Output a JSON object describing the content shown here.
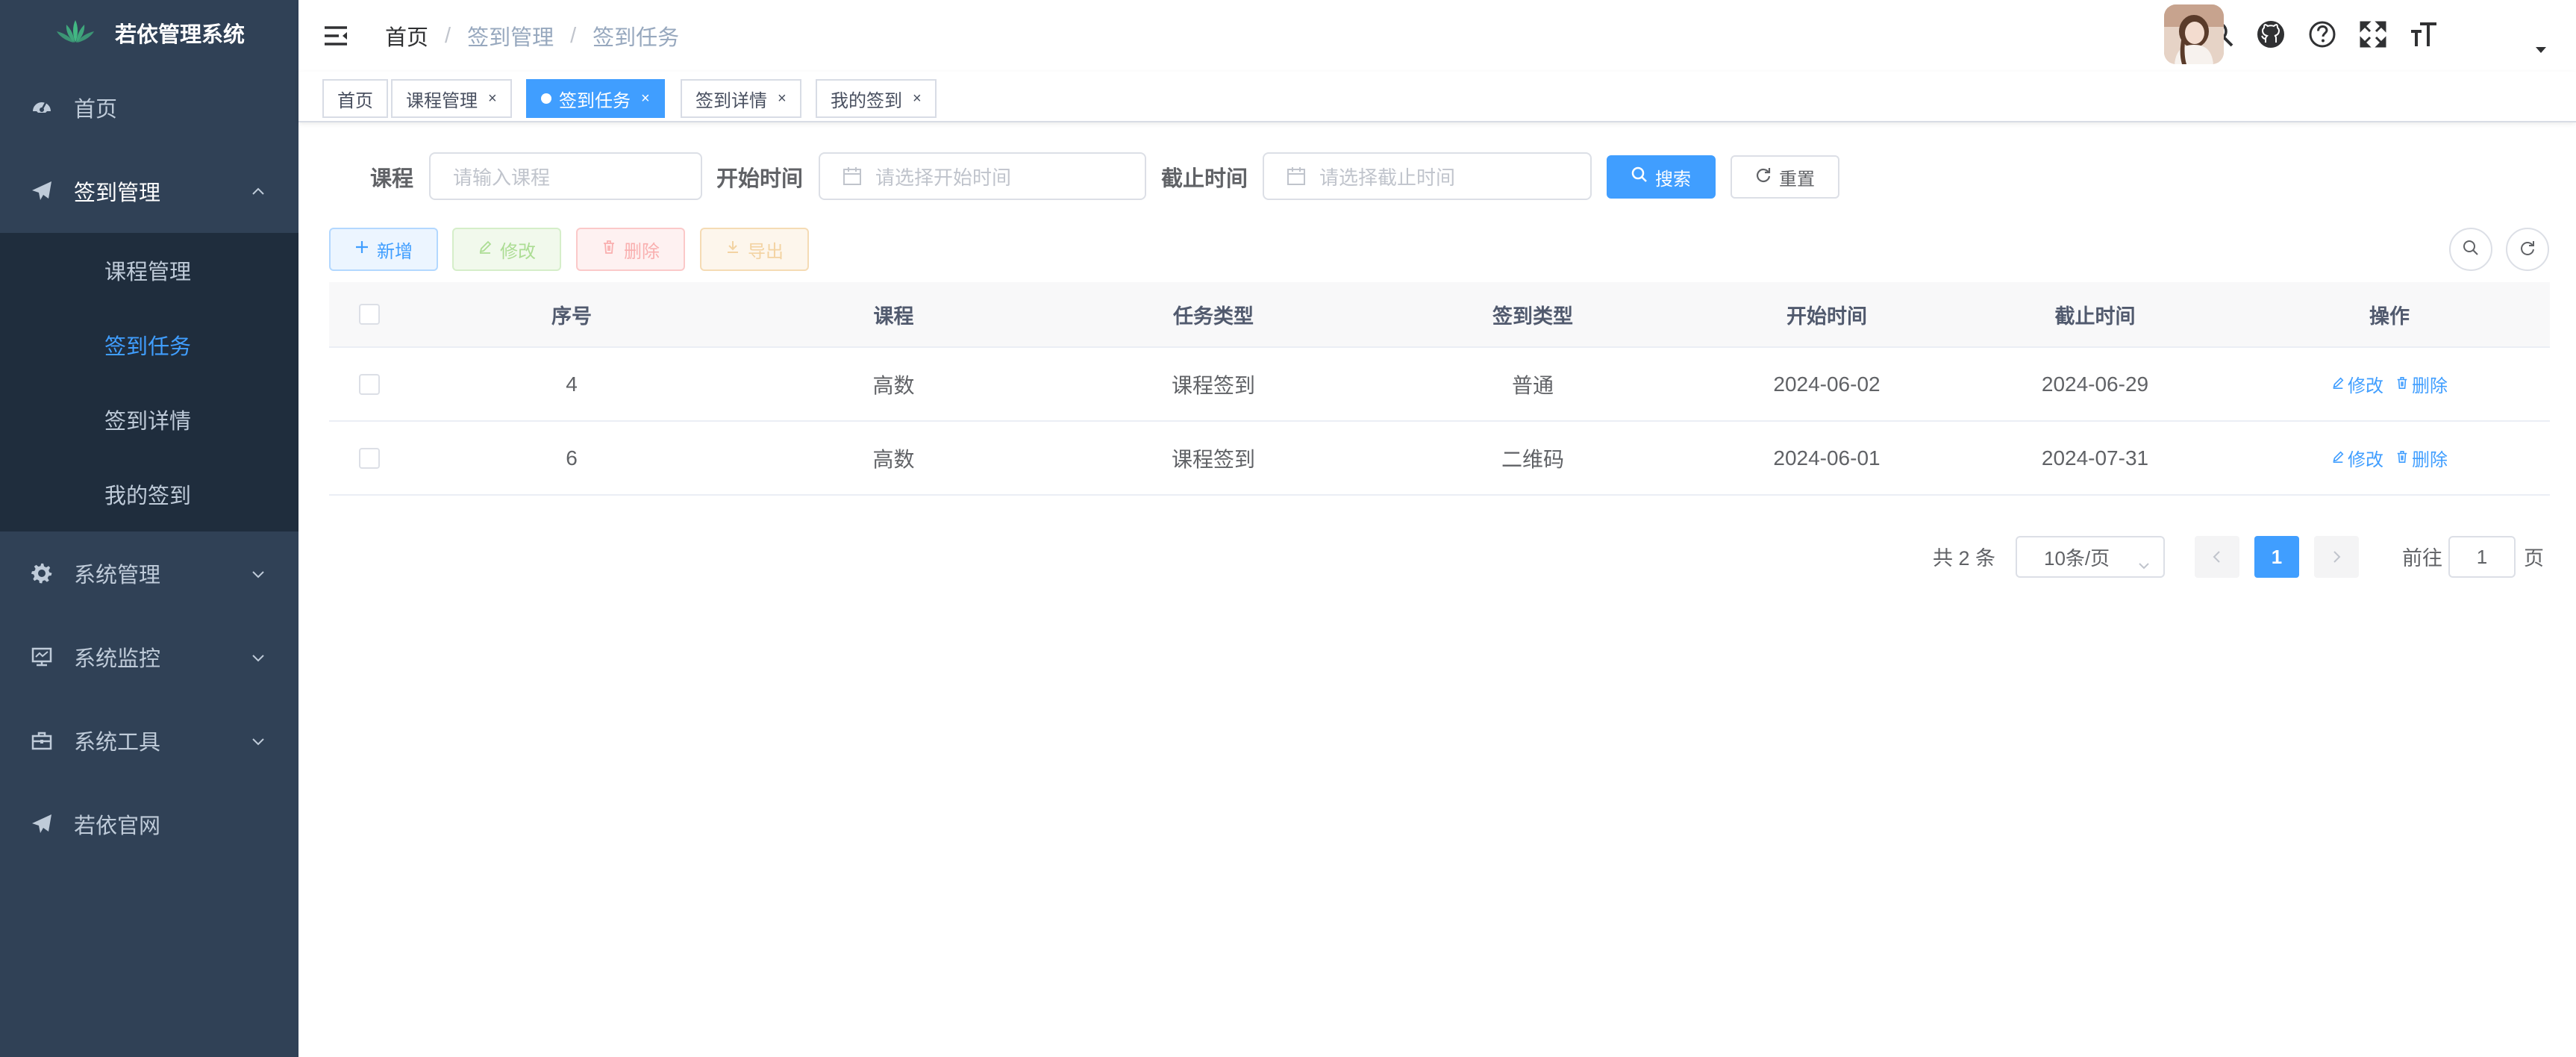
{
  "app": {
    "title": "若依管理系统",
    "logo_icon": "lotus-logo"
  },
  "sidebar": {
    "items": [
      {
        "label": "首页",
        "icon": "dashboard-icon"
      },
      {
        "label": "签到管理",
        "icon": "paper-plane-icon",
        "expanded": true,
        "children": [
          {
            "label": "课程管理",
            "active": false
          },
          {
            "label": "签到任务",
            "active": true
          },
          {
            "label": "签到详情",
            "active": false
          },
          {
            "label": "我的签到",
            "active": false
          }
        ]
      },
      {
        "label": "系统管理",
        "icon": "gear-icon"
      },
      {
        "label": "系统监控",
        "icon": "monitor-icon"
      },
      {
        "label": "系统工具",
        "icon": "toolbox-icon"
      },
      {
        "label": "若依官网",
        "icon": "paper-plane-icon"
      }
    ]
  },
  "navbar": {
    "breadcrumb": [
      "首页",
      "签到管理",
      "签到任务"
    ],
    "separator": "/",
    "icons": [
      "search-icon",
      "github-icon",
      "help-icon",
      "fullscreen-icon",
      "font-size-icon"
    ]
  },
  "tags": [
    {
      "label": "首页",
      "closable": false,
      "active": false
    },
    {
      "label": "课程管理",
      "closable": true,
      "active": false
    },
    {
      "label": "签到任务",
      "closable": true,
      "active": true
    },
    {
      "label": "签到详情",
      "closable": true,
      "active": false
    },
    {
      "label": "我的签到",
      "closable": true,
      "active": false
    }
  ],
  "search": {
    "course_label": "课程",
    "course_placeholder": "请输入课程",
    "start_label": "开始时间",
    "start_placeholder": "请选择开始时间",
    "end_label": "截止时间",
    "end_placeholder": "请选择截止时间",
    "search_btn": "搜索",
    "reset_btn": "重置"
  },
  "toolbar": {
    "add": "新增",
    "edit": "修改",
    "delete": "删除",
    "export": "导出"
  },
  "table": {
    "columns": [
      "序号",
      "课程",
      "任务类型",
      "签到类型",
      "开始时间",
      "截止时间",
      "操作"
    ],
    "rows": [
      {
        "id": "4",
        "course": "高数",
        "task_type": "课程签到",
        "sign_type": "普通",
        "start": "2024-06-02",
        "end": "2024-06-29"
      },
      {
        "id": "6",
        "course": "高数",
        "task_type": "课程签到",
        "sign_type": "二维码",
        "start": "2024-06-01",
        "end": "2024-07-31"
      }
    ],
    "op_edit": "修改",
    "op_delete": "删除"
  },
  "pagination": {
    "total_text": "共 2 条",
    "page_size": "10条/页",
    "current_page": "1",
    "jump_prefix": "前往",
    "jump_value": "1",
    "jump_suffix": "页"
  },
  "colors": {
    "primary": "#409eff",
    "sidebar_bg": "#304156",
    "submenu_bg": "#1f2d3d",
    "sidebar_text": "#bfcbd9"
  }
}
